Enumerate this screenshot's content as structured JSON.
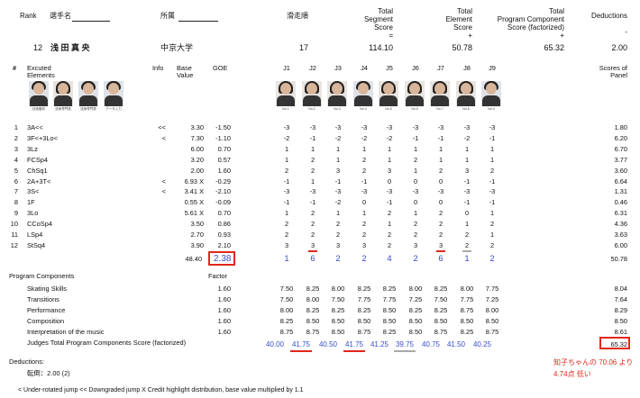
{
  "header": {
    "rank_label": "Rank",
    "name_label": "選手名",
    "club_label": "所属",
    "order_label": "滑走順",
    "tss_label": [
      "Total",
      "Segment",
      "Score",
      "="
    ],
    "tes_label": [
      "Total",
      "Element",
      "Score",
      "+"
    ],
    "pcs_label": [
      "Total",
      "Program Component",
      "Score (factorized)",
      "+"
    ],
    "ded_label": [
      "Deductions",
      "-"
    ]
  },
  "skater": {
    "rank": "12",
    "name": "浅 田 真 央",
    "club": "中京大学",
    "order": "17",
    "tss": "114.10",
    "tes": "50.78",
    "pcs": "65.32",
    "ded": "2.00"
  },
  "columns": {
    "num": "#",
    "elements": [
      "Excuted",
      "Elements"
    ],
    "info": "Info",
    "base": [
      "Base",
      "Value"
    ],
    "goe": "GOE",
    "judges": [
      "J1",
      "J2",
      "J3",
      "J4",
      "J5",
      "J6",
      "J7",
      "J8",
      "J9"
    ],
    "panel": [
      "Scores of",
      "Panel"
    ]
  },
  "tech_captions": [
    "技術審判",
    "技術専門員",
    "技術専門員",
    "データ入力"
  ],
  "judge_captions": [
    "No.1",
    "No.2",
    "No.3",
    "No.4",
    "No.5",
    "No.6",
    "No.7",
    "No.8",
    "No.9"
  ],
  "elements": [
    {
      "n": "1",
      "el": "3A<<",
      "info": "<<",
      "bv": "3.30",
      "goe": "-1.50",
      "j": [
        "-3",
        "-3",
        "-3",
        "-3",
        "-3",
        "-3",
        "-3",
        "-3",
        "-3"
      ],
      "sp": "1.80"
    },
    {
      "n": "2",
      "el": "3F<+3Lo<",
      "info": "<",
      "bv": "7.30",
      "goe": "-1.10",
      "j": [
        "-2",
        "-1",
        "-2",
        "-2",
        "-2",
        "-1",
        "-1",
        "-2",
        "-1"
      ],
      "sp": "6.20"
    },
    {
      "n": "3",
      "el": "3Lz",
      "info": "",
      "bv": "6.00",
      "goe": "0.70",
      "j": [
        "1",
        "1",
        "1",
        "1",
        "1",
        "1",
        "1",
        "1",
        "1"
      ],
      "sp": "6.70"
    },
    {
      "n": "4",
      "el": "FCSp4",
      "info": "",
      "bv": "3.20",
      "goe": "0.57",
      "j": [
        "1",
        "2",
        "1",
        "2",
        "1",
        "2",
        "1",
        "1",
        "1"
      ],
      "sp": "3.77"
    },
    {
      "n": "5",
      "el": "ChSq1",
      "info": "",
      "bv": "2.00",
      "goe": "1.60",
      "j": [
        "2",
        "2",
        "3",
        "2",
        "3",
        "1",
        "2",
        "3",
        "2"
      ],
      "sp": "3.60"
    },
    {
      "n": "6",
      "el": "2A+3T<",
      "info": "<",
      "bv": "6.93 X",
      "goe": "-0.29",
      "j": [
        "-1",
        "1",
        "-1",
        "-1",
        "0",
        "0",
        "0",
        "-1",
        "-1"
      ],
      "sp": "6.64"
    },
    {
      "n": "7",
      "el": "3S<",
      "info": "<",
      "bv": "3.41 X",
      "goe": "-2.10",
      "j": [
        "-3",
        "-3",
        "-3",
        "-3",
        "-3",
        "-3",
        "-3",
        "-3",
        "-3"
      ],
      "sp": "1.31"
    },
    {
      "n": "8",
      "el": "1F",
      "info": "",
      "bv": "0.55 X",
      "goe": "-0.09",
      "j": [
        "-1",
        "-1",
        "-2",
        "0",
        "-1",
        "0",
        "0",
        "-1",
        "-1"
      ],
      "sp": "0.46"
    },
    {
      "n": "9",
      "el": "3Lo",
      "info": "",
      "bv": "5.61 X",
      "goe": "0.70",
      "j": [
        "1",
        "2",
        "1",
        "1",
        "2",
        "1",
        "2",
        "0",
        "1"
      ],
      "sp": "6.31"
    },
    {
      "n": "10",
      "el": "CCoSp4",
      "info": "",
      "bv": "3.50",
      "goe": "0.86",
      "j": [
        "2",
        "2",
        "2",
        "2",
        "1",
        "2",
        "2",
        "1",
        "2"
      ],
      "sp": "4.36"
    },
    {
      "n": "11",
      "el": "LSp4",
      "info": "",
      "bv": "2.70",
      "goe": "0.93",
      "j": [
        "2",
        "2",
        "2",
        "2",
        "2",
        "2",
        "2",
        "2",
        "1"
      ],
      "sp": "3.63"
    },
    {
      "n": "12",
      "el": "StSq4",
      "info": "",
      "bv": "3.90",
      "goe": "2.10",
      "j": [
        "3",
        "3",
        "3",
        "3",
        "2",
        "3",
        "3",
        "2",
        "2"
      ],
      "sp": "6.00"
    }
  ],
  "element_totals": {
    "bv": "48.40",
    "goe": "2.38",
    "j": [
      "1",
      "6",
      "2",
      "2",
      "4",
      "2",
      "6",
      "1",
      "2"
    ],
    "sp": "50.78"
  },
  "pc_section": {
    "title": "Program Components",
    "factor_label": "Factor",
    "rows": [
      {
        "name": "Skating Skills",
        "factor": "1.60",
        "j": [
          "7.50",
          "8.25",
          "8.00",
          "8.25",
          "8.25",
          "8.00",
          "8.25",
          "8.00",
          "7.75"
        ],
        "sp": "8.04"
      },
      {
        "name": "Transitions",
        "factor": "1.60",
        "j": [
          "7.50",
          "8.00",
          "7.50",
          "7.75",
          "7.75",
          "7.25",
          "7.50",
          "7.75",
          "7.25"
        ],
        "sp": "7.64"
      },
      {
        "name": "Performance",
        "factor": "1.60",
        "j": [
          "8.00",
          "8.25",
          "8.25",
          "8.25",
          "8.50",
          "8.25",
          "8.25",
          "8.75",
          "8.00"
        ],
        "sp": "8.29"
      },
      {
        "name": "Composition",
        "factor": "1.60",
        "j": [
          "8.25",
          "8.50",
          "8.50",
          "8.50",
          "8.50",
          "8.50",
          "8.50",
          "8.50",
          "8.50"
        ],
        "sp": "8.50"
      },
      {
        "name": "Interpretation of the music",
        "factor": "1.60",
        "j": [
          "8.75",
          "8.75",
          "8.50",
          "8.75",
          "8.25",
          "8.50",
          "8.75",
          "8.25",
          "8.75"
        ],
        "sp": "8.61"
      }
    ],
    "total_label": "Judges Total Program Components Score (factorized)",
    "totals": [
      "40.00",
      "41.75",
      "40.50",
      "41.75",
      "41.25",
      "39.75",
      "40.75",
      "41.50",
      "40.25"
    ],
    "total_sp": "65.32"
  },
  "deductions": {
    "title": "Deductions:",
    "detail": "転倒：2.00 (2)"
  },
  "footnote": "<< Downgraded jump",
  "footnote_full": "< Under-rotated jump    << Downgraded jump    X Credit highlight distribution, base value multiplied by 1.1",
  "annotation": [
    "知子ちゃんの 70.06 より",
    "4.74点 低い"
  ],
  "colors": {
    "accent_red": "#e0281c",
    "blue_text": "#3a4fc8"
  }
}
